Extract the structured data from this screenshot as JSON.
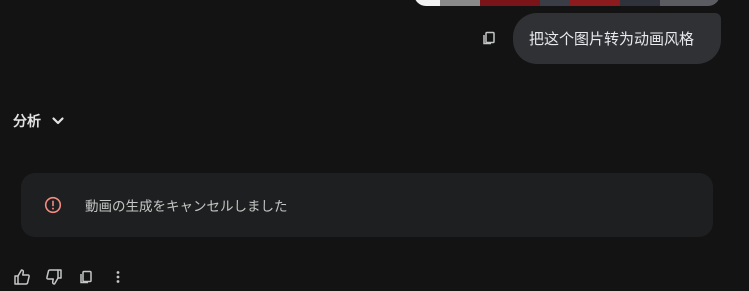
{
  "user_message": {
    "text": "把这个图片转为动画风格",
    "copy_icon": "copy-icon"
  },
  "analysis": {
    "label": "分析",
    "icon": "chevron-down-icon"
  },
  "notice": {
    "icon": "error-circle-icon",
    "icon_color": "#f28b82",
    "text": "動画の生成をキャンセルしました"
  },
  "actions": {
    "icons": [
      "thumb-up-icon",
      "thumb-down-icon",
      "copy-icon",
      "more-vert-icon"
    ]
  },
  "colors": {
    "background": "#131314",
    "bubble": "#303134",
    "card": "#1e1f20"
  }
}
